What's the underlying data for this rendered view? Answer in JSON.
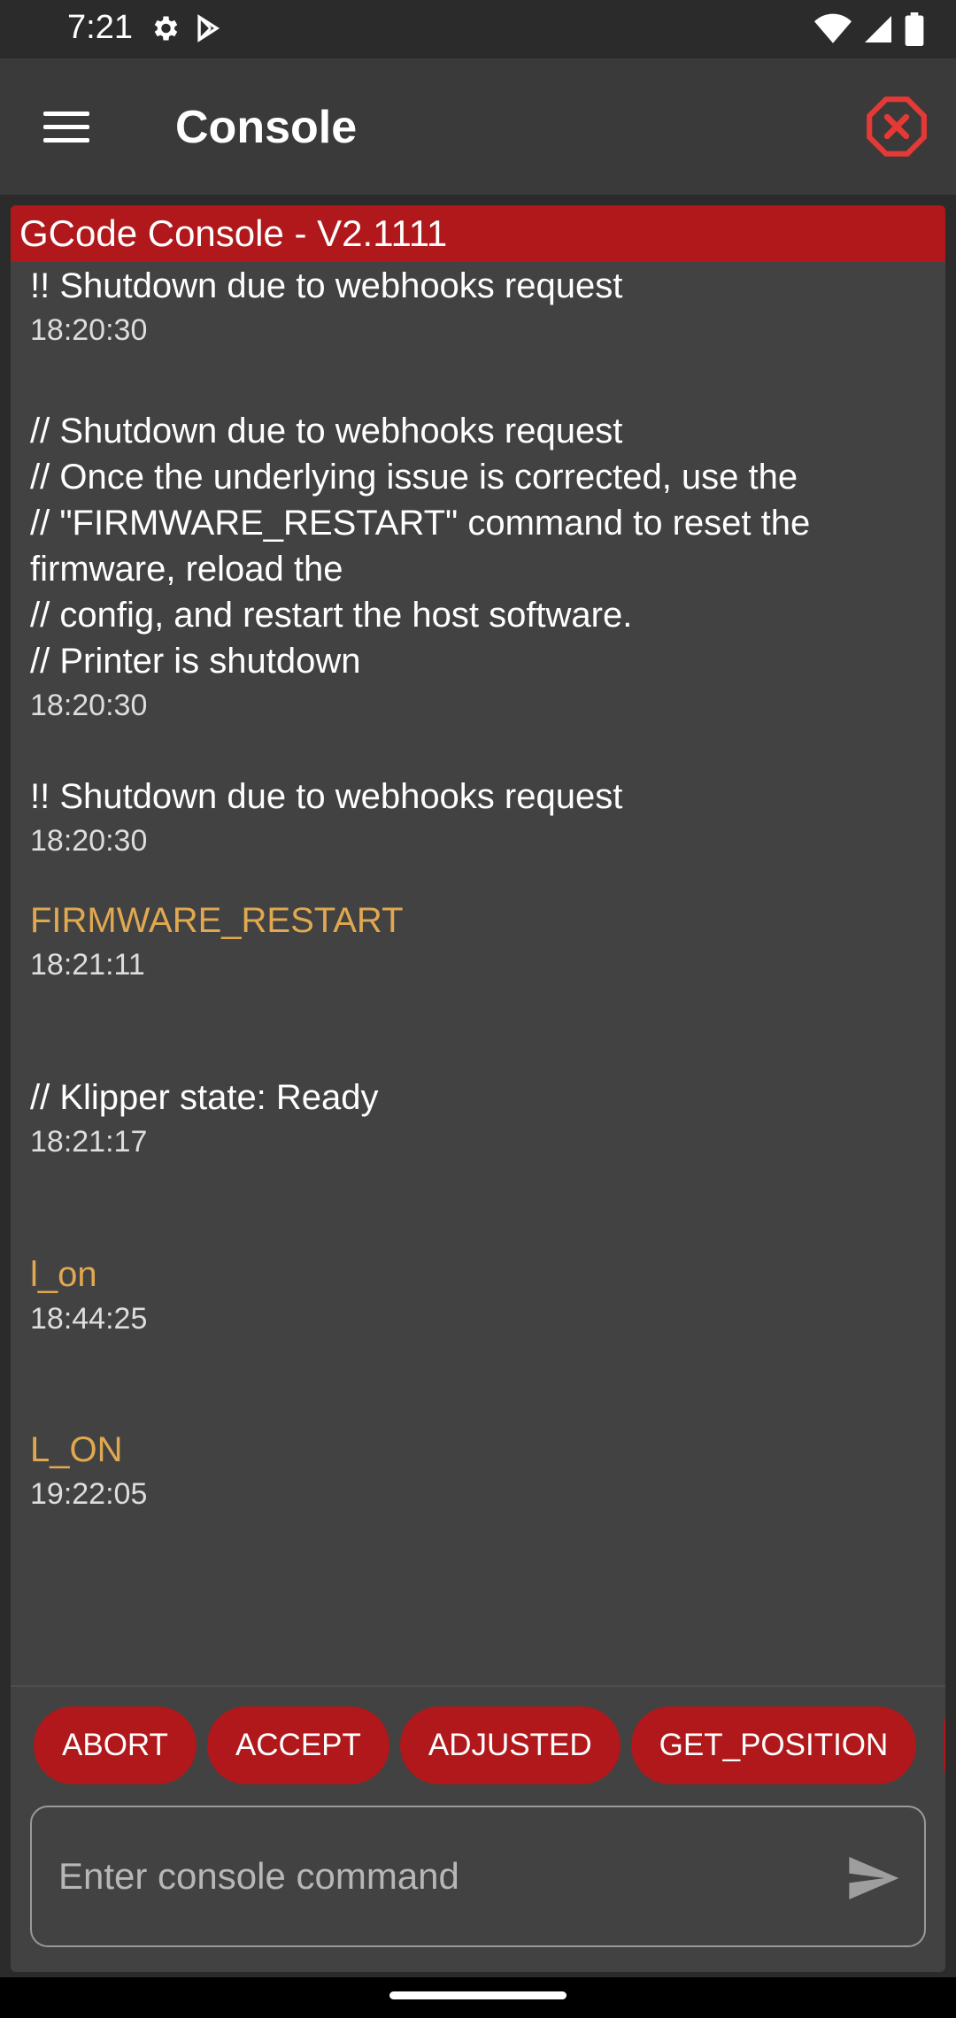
{
  "status_bar": {
    "time": "7:21",
    "icons_left": [
      "gear-icon",
      "play-store-icon"
    ],
    "icons_right": [
      "wifi-icon",
      "signal-icon",
      "battery-icon"
    ]
  },
  "app_bar": {
    "title": "Console",
    "menu_icon": "hamburger-menu-icon",
    "close_icon": "octagon-close-icon",
    "close_color": "#e53935"
  },
  "console": {
    "header": "GCode Console - V2.1111",
    "header_color": "#b0181b",
    "entries": [
      {
        "type": "response",
        "message": "!! Shutdown due to webhooks request",
        "time": "18:20:30"
      },
      {
        "type": "response",
        "message": "// Shutdown due to webhooks request\n// Once the underlying issue is corrected, use the\n// \"FIRMWARE_RESTART\" command to reset the\nfirmware, reload the\n// config, and restart the host software.\n// Printer is shutdown",
        "time": "18:20:30"
      },
      {
        "type": "response",
        "message": "!! Shutdown due to webhooks request",
        "time": "18:20:30"
      },
      {
        "type": "command",
        "message": "FIRMWARE_RESTART",
        "time": "18:21:11"
      },
      {
        "type": "response",
        "message": "// Klipper state: Ready",
        "time": "18:21:17"
      },
      {
        "type": "command",
        "message": "l_on",
        "time": "18:44:25"
      },
      {
        "type": "command",
        "message": "L_ON",
        "time": "19:22:05"
      }
    ],
    "command_color": "#e0a850"
  },
  "macros": [
    "ABORT",
    "ACCEPT",
    "ADJUSTED",
    "GET_POSITION"
  ],
  "input": {
    "placeholder": "Enter console command",
    "value": "",
    "send_icon": "send-icon"
  }
}
